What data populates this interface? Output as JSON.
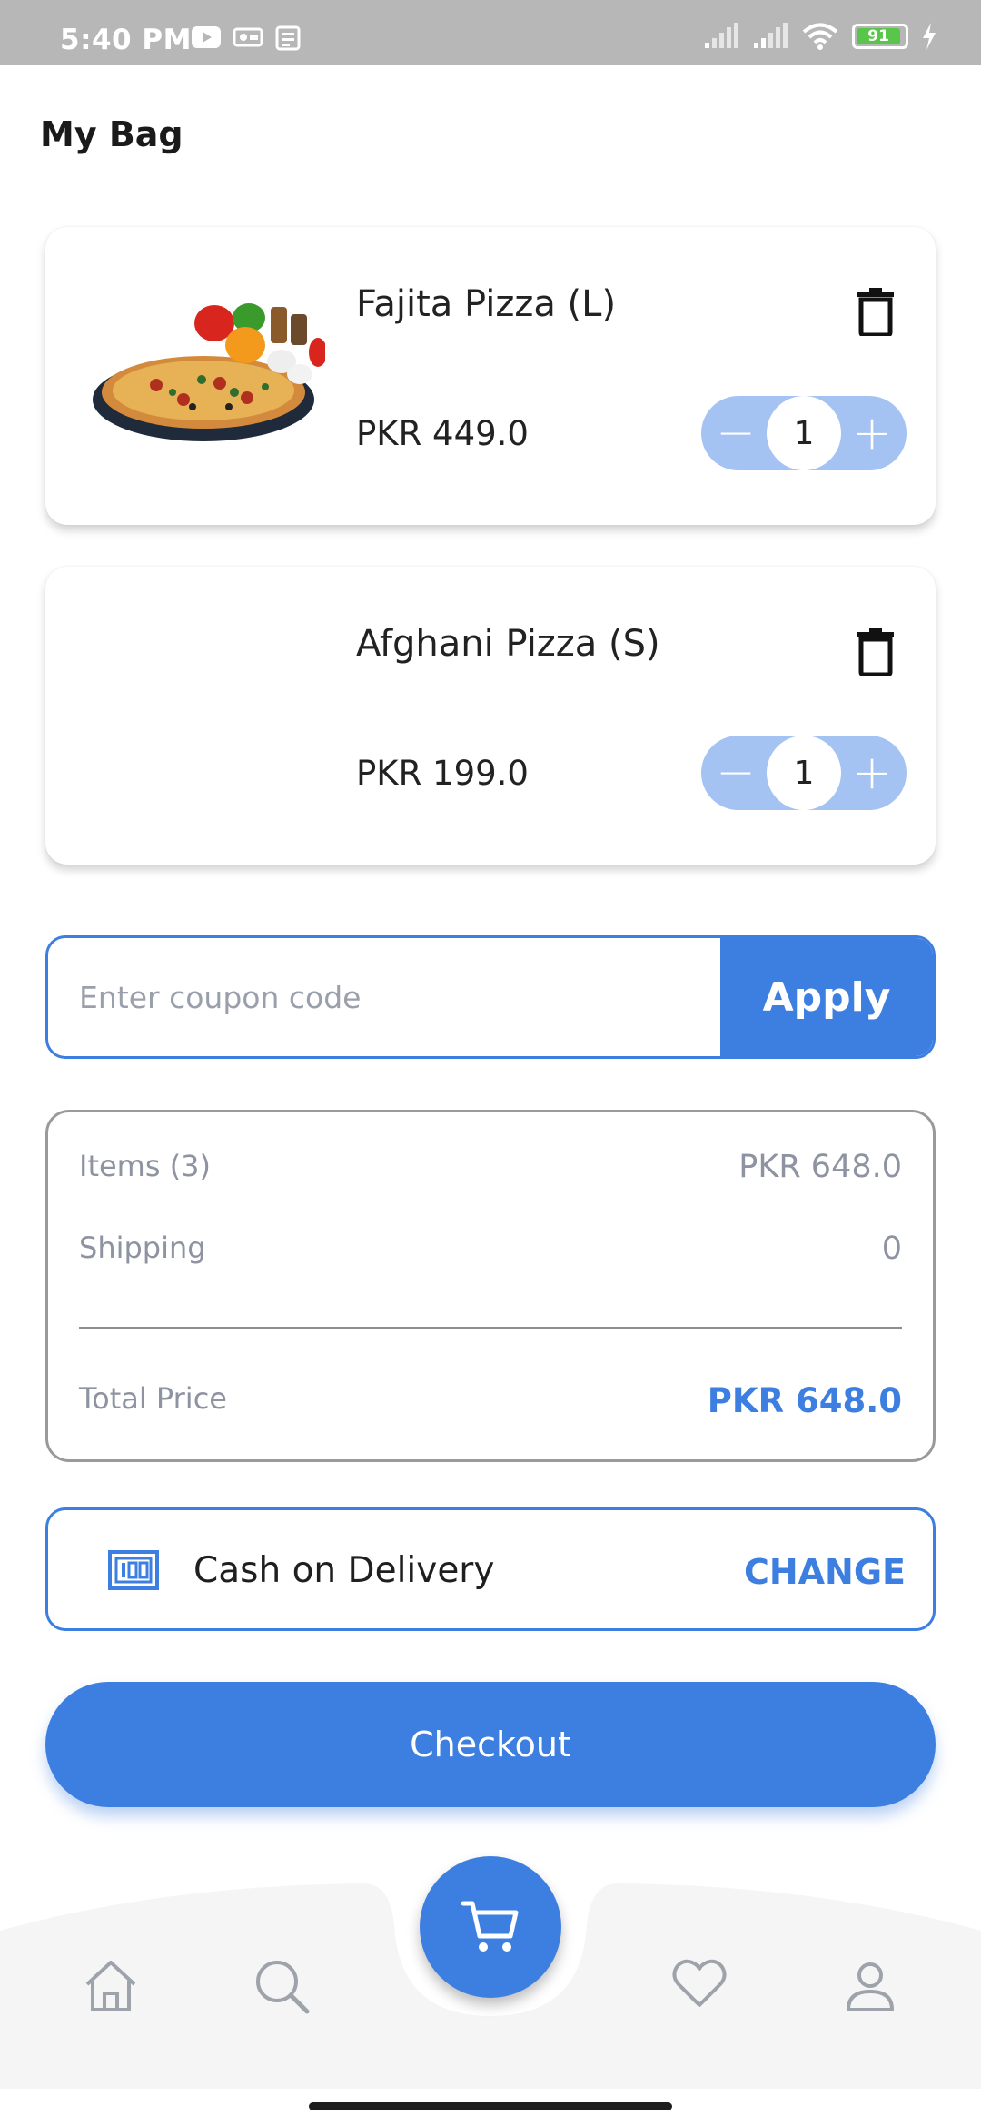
{
  "status_bar": {
    "time": "5:40 PM",
    "battery": "91"
  },
  "page": {
    "title": "My Bag"
  },
  "cart": {
    "items": [
      {
        "name": "Fajita Pizza (L)",
        "price": "PKR  449.0",
        "quantity": "1",
        "has_image": true
      },
      {
        "name": "Afghani Pizza (S)",
        "price": "PKR  199.0",
        "quantity": "1",
        "has_image": false
      }
    ],
    "stepper": {
      "minus": "−",
      "plus": "+"
    }
  },
  "coupon": {
    "placeholder": "Enter coupon code",
    "value": "",
    "apply_label": "Apply"
  },
  "summary": {
    "items_label": "Items (3)",
    "items_value": "PKR  648.0",
    "shipping_label": "Shipping",
    "shipping_value": "0",
    "total_label": "Total Price",
    "total_value": "PKR  648.0"
  },
  "payment": {
    "method": "Cash on Delivery",
    "change_label": "CHANGE"
  },
  "checkout": {
    "label": "Checkout"
  },
  "colors": {
    "accent": "#3d7fe0",
    "stepper_bg": "#a4c2f2",
    "muted_text": "#8d93a0",
    "status_bar": "#b7b7b7"
  },
  "icons": {
    "status_left": [
      "youtube-icon",
      "media-icon",
      "news-icon"
    ],
    "status_right": [
      "signal-icon",
      "signal-icon",
      "wifi-icon",
      "battery-icon",
      "charging-icon"
    ],
    "bottom_nav": [
      "home-icon",
      "search-icon",
      "cart-icon",
      "heart-icon",
      "profile-icon"
    ]
  }
}
